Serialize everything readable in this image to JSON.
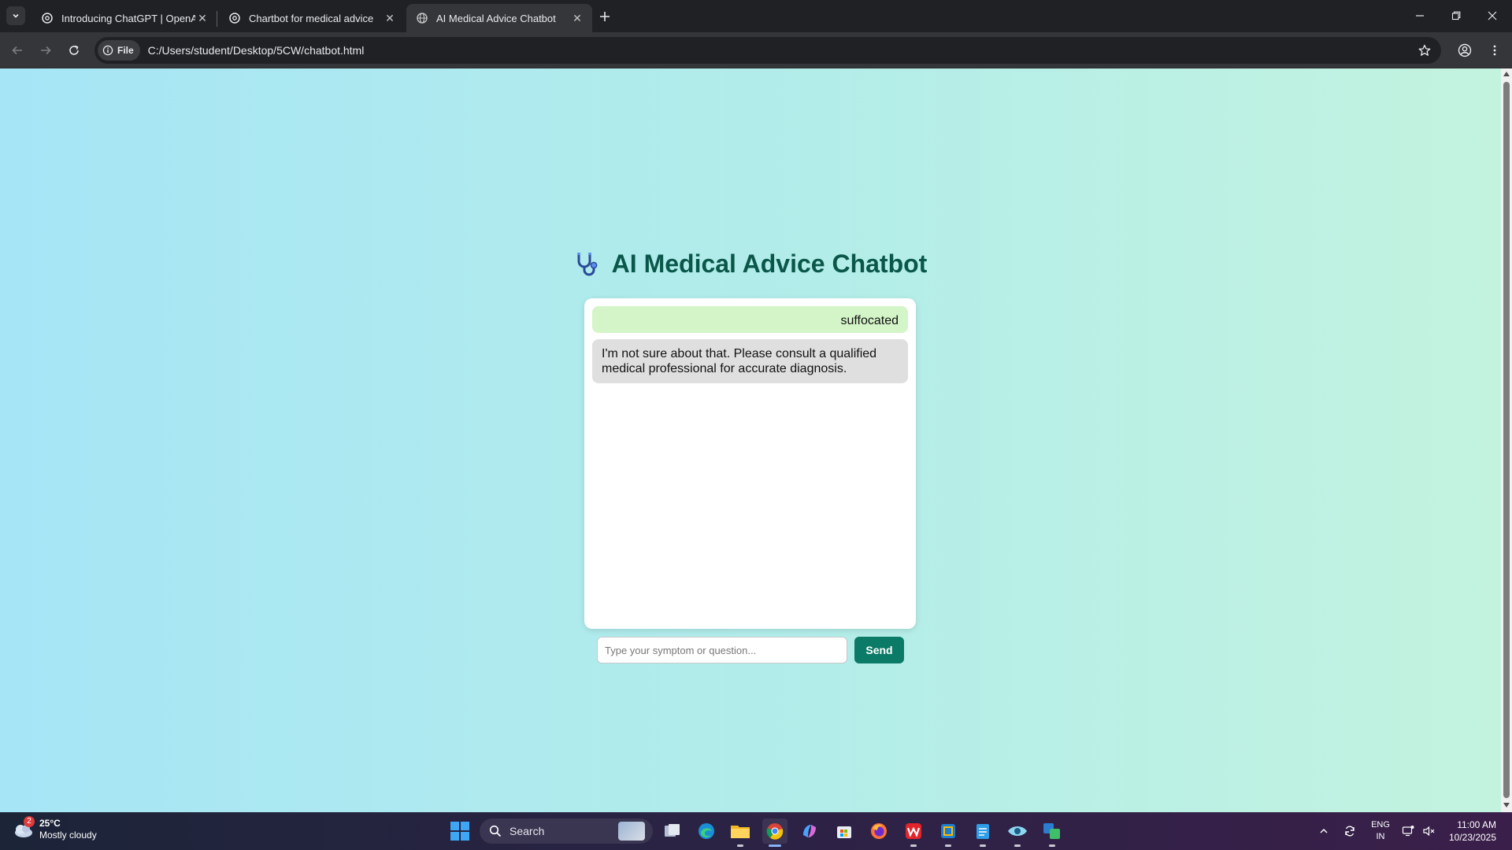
{
  "browser": {
    "tabs": [
      {
        "title": "Introducing ChatGPT | OpenAI",
        "active": false
      },
      {
        "title": "Chartbot for medical advice",
        "active": false
      },
      {
        "title": "AI Medical Advice Chatbot",
        "active": true
      }
    ],
    "site_chip": "File",
    "url": "C:/Users/student/Desktop/5CW/chatbot.html"
  },
  "page": {
    "heading": "AI Medical Advice Chatbot",
    "heading_icon": "stethoscope-icon",
    "messages": [
      {
        "sender": "user",
        "text": "suffocated"
      },
      {
        "sender": "bot",
        "text": "I'm not sure about that. Please consult a qualified medical professional for accurate diagnosis."
      }
    ],
    "input": {
      "value": "",
      "placeholder": "Type your symptom or question..."
    },
    "send_label": "Send"
  },
  "taskbar": {
    "weather": {
      "temp": "25°C",
      "condition": "Mostly cloudy",
      "badge": "2"
    },
    "search_label": "Search",
    "lang_line1": "ENG",
    "lang_line2": "IN",
    "time": "11:00 AM",
    "date": "10/23/2025"
  },
  "colors": {
    "heading": "#0a5749",
    "send_button": "#0b7a66",
    "user_bubble": "#d4f5c8",
    "bot_bubble": "#dfdfdf"
  }
}
